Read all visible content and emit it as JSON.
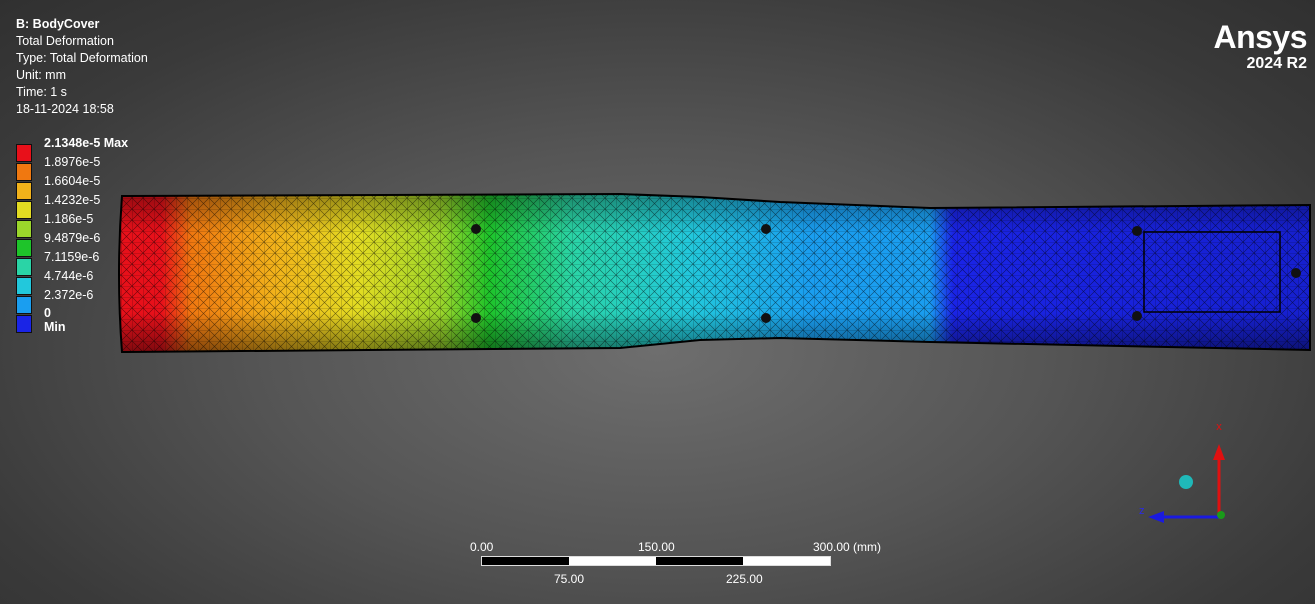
{
  "header": {
    "title": "B: BodyCover",
    "line1": "Total Deformation",
    "line2": "Type: Total Deformation",
    "line3": "Unit: mm",
    "line4": "Time: 1 s",
    "line5": "18-11-2024 18:58"
  },
  "legend": {
    "max_label": "2.1348e-5 Max",
    "values": [
      "1.8976e-5",
      "1.6604e-5",
      "1.4232e-5",
      "1.186e-5",
      "9.4879e-6",
      "7.1159e-6",
      "4.744e-6",
      "2.372e-6"
    ],
    "min_label": "0 Min",
    "colors": [
      "#e8101a",
      "#f07810",
      "#f2b21a",
      "#e3dc22",
      "#9bd62b",
      "#1ec42a",
      "#2ad4a6",
      "#22c8dc",
      "#1a9ef0",
      "#1a24e6"
    ]
  },
  "brand": {
    "name": "Ansys",
    "version": "2024 R2"
  },
  "scale_bar": {
    "top_labels": [
      "0.00",
      "150.00",
      "300.00 (mm)"
    ],
    "bottom_labels": [
      "75.00",
      "225.00"
    ]
  },
  "triad": {
    "x_label": "x",
    "z_label": "z"
  }
}
